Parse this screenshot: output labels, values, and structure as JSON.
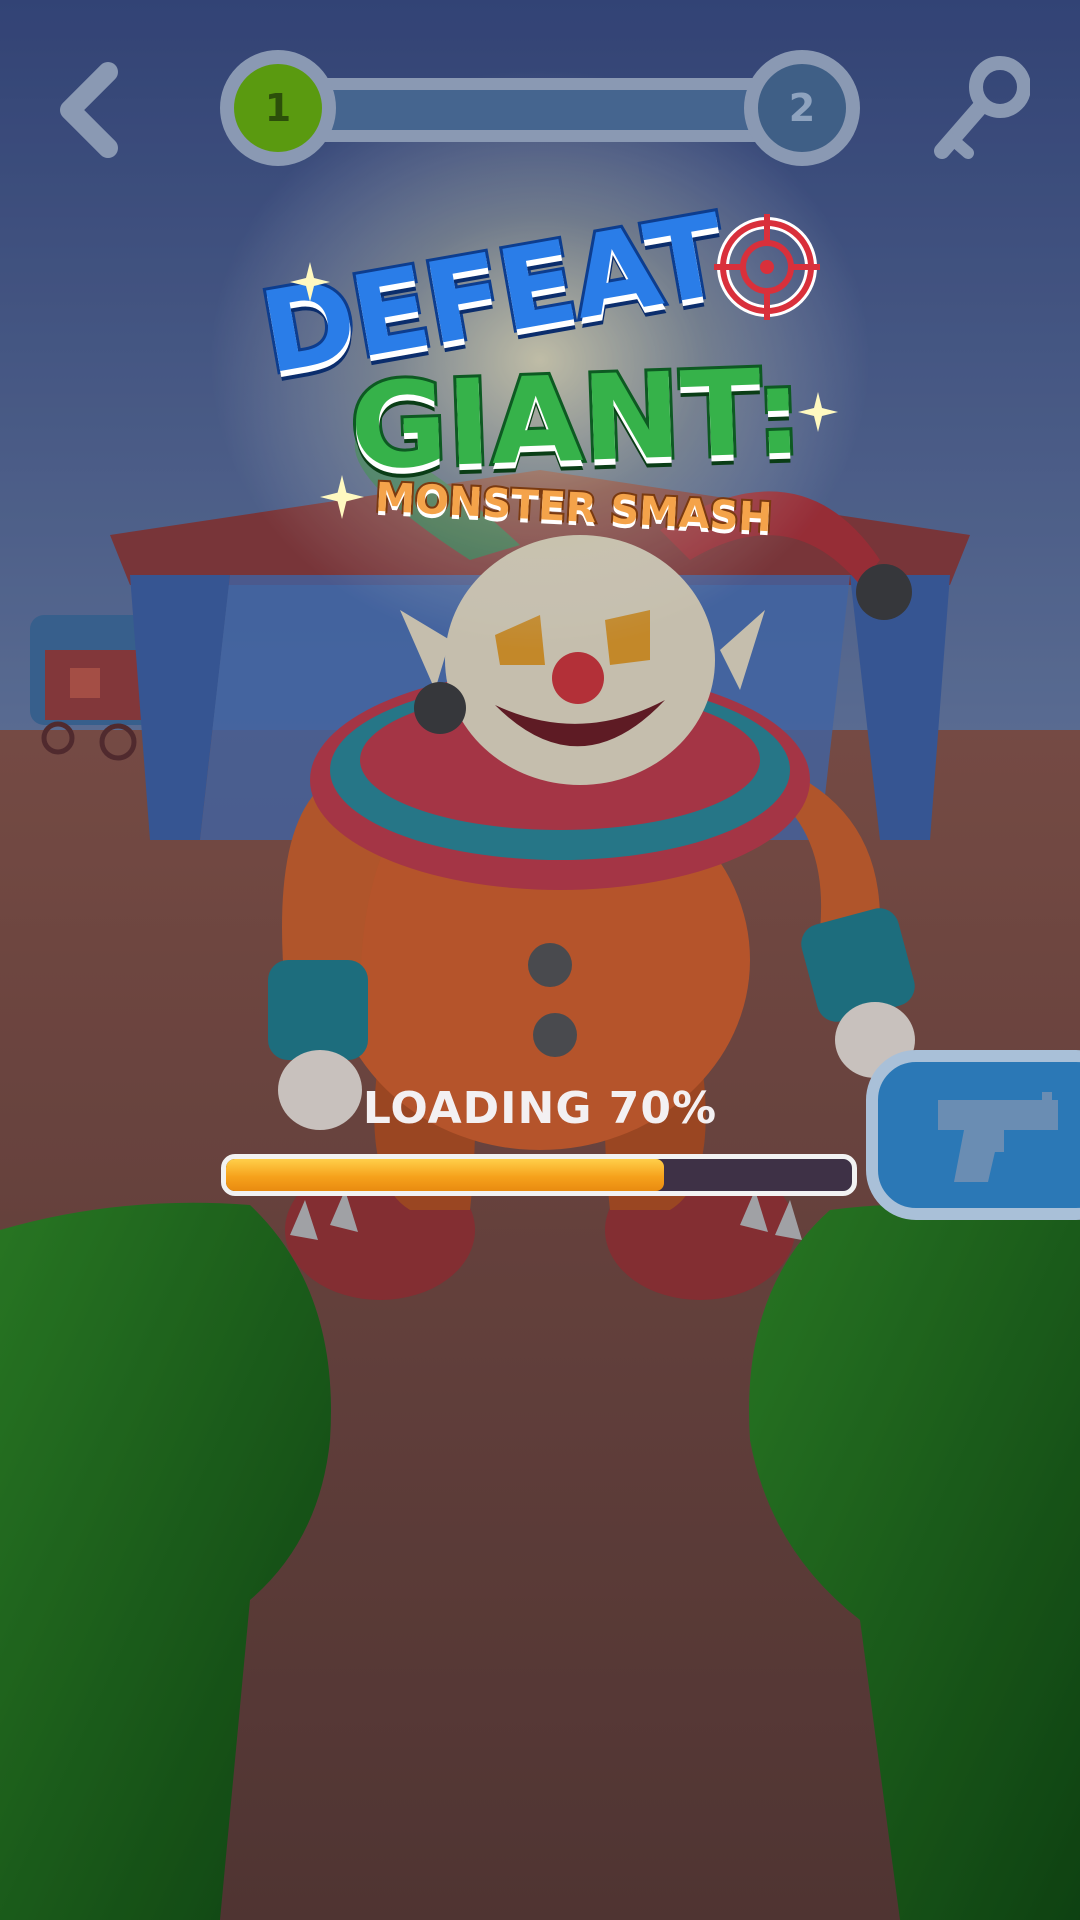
{
  "hud": {
    "back_icon": "chevron-left-icon",
    "level_current": "1",
    "level_next": "2",
    "key_icon": "key-icon"
  },
  "logo": {
    "line1": "DEFEAT",
    "line2": "GIANT:",
    "subtitle": "MONSTER SMASH",
    "target_icon": "crosshair-target-icon"
  },
  "loading": {
    "label": "LOADING 70%",
    "progress": 0.7
  },
  "weapon": {
    "icon": "pistol-icon"
  },
  "colors": {
    "sky": "#3a4f86",
    "ground": "#6a4236",
    "tent_red": "#8e3b3b",
    "tent_blue": "#3d62a8",
    "clown_orange": "#d8612a",
    "gloves_green": "#1f7a1a",
    "progress_fill": "#f6a21c"
  }
}
